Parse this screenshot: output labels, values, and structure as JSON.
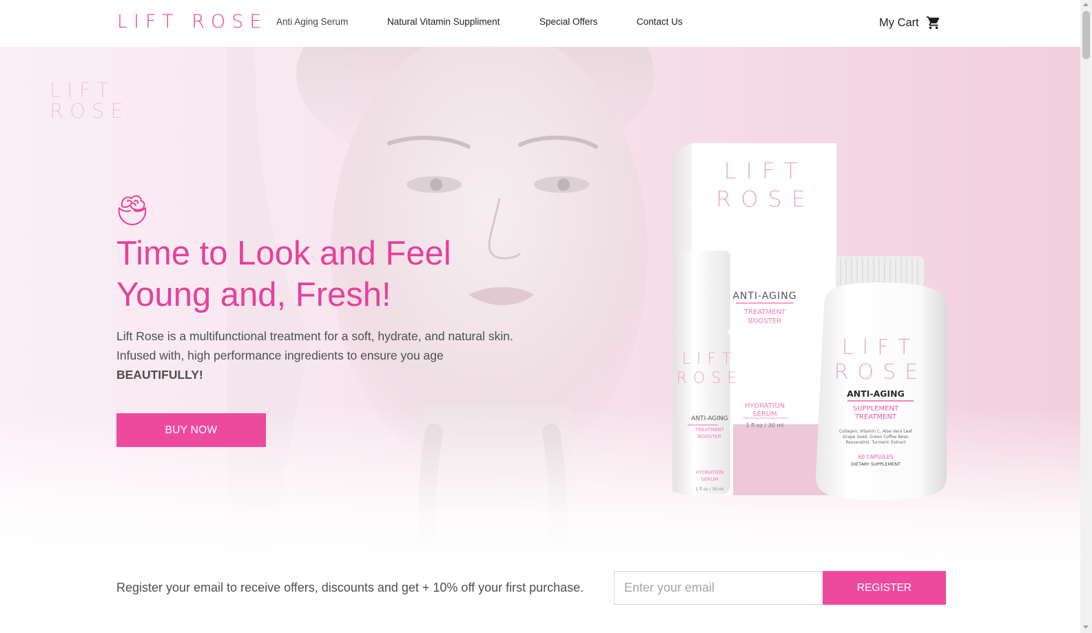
{
  "brand": {
    "logo_text": "LIFT ROSE",
    "watermark_line1": "LIFT",
    "watermark_line2": "ROSE",
    "accent_color": "#ee4a9d"
  },
  "nav": {
    "items": [
      {
        "label": "Anti Aging Serum"
      },
      {
        "label": "Natural Vitamin Suppliment"
      },
      {
        "label": "Special Offers"
      },
      {
        "label": "Contact Us"
      }
    ]
  },
  "cart": {
    "label": "My Cart",
    "icon": "shopping-cart-icon"
  },
  "hero": {
    "icon": "rose-icon",
    "title": "Time to Look and Feel Young and, Fresh!",
    "description": "Lift Rose is a multifunctional treatment for a soft, hydrate, and natural skin. Infused with, high performance ingredients to ensure you age",
    "emphasis": "BEAUTIFULLY!",
    "buy_button": "BUY NOW"
  },
  "products": {
    "box": {
      "brand_line1": "LIFT",
      "brand_line2": "ROSE",
      "heading": "ANTI-AGING",
      "subheading_line1": "TREATMENT",
      "subheading_line2": "BOOSTER",
      "type_line1": "HYDRATION",
      "type_line2": "SERUM",
      "volume": "1 fl oz / 30 ml"
    },
    "serum_bottle": {
      "brand_line1": "LIFT",
      "brand_line2": "ROSE",
      "heading": "ANTI-AGING",
      "subheading_line1": "TREATMENT",
      "subheading_line2": "BOOSTER",
      "type_line1": "HYDRATION",
      "type_line2": "SERUM",
      "volume": "1 fl oz / 30 ml"
    },
    "supplement_jar": {
      "brand_line1": "LIFT",
      "brand_line2": "ROSE",
      "heading": "ANTI-AGING",
      "subheading_line1": "SUPPLEMENT",
      "subheading_line2": "TREATMENT",
      "ingredients_line1": "Collagen, Vitamin C, Aloe Vera Leaf",
      "ingredients_line2": "Grape Seed, Green Coffee Bean",
      "ingredients_line3": "Resveratrol, Turmeric Extract",
      "count": "60 CAPSULES",
      "kind": "DIETARY SUPPLEMENT"
    }
  },
  "newsletter": {
    "text": "Register your email to receive offers, discounts and get + 10% off your first purchase.",
    "email_placeholder": "Enter your email",
    "email_value": "",
    "register_button": "REGISTER"
  }
}
